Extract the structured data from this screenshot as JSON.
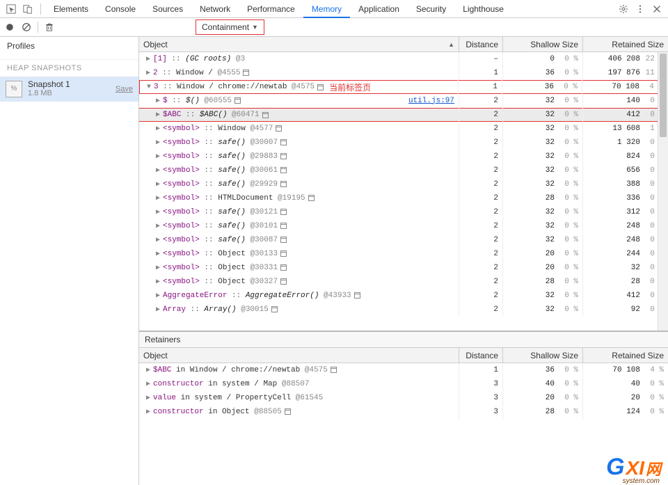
{
  "tabs": [
    "Elements",
    "Console",
    "Sources",
    "Network",
    "Performance",
    "Memory",
    "Application",
    "Security",
    "Lighthouse"
  ],
  "active_tab": "Memory",
  "dropdown": {
    "label": "Containment"
  },
  "sidebar": {
    "profiles_label": "Profiles",
    "section_label": "HEAP SNAPSHOTS",
    "snapshot_name": "Snapshot 1",
    "snapshot_size": "1.8 MB",
    "save_label": "Save"
  },
  "columns": {
    "object": "Object",
    "distance": "Distance",
    "shallow": "Shallow Size",
    "retained": "Retained Size"
  },
  "rows": [
    {
      "indent": 0,
      "exp": "closed",
      "key": "[1]",
      "sep": " :: ",
      "ctor": "(GC roots)",
      "objid": "@3",
      "win": false,
      "dist": "–",
      "shallow": "0",
      "spct": "0 %",
      "ret": "406 208",
      "rpct": "22 %"
    },
    {
      "indent": 0,
      "exp": "closed",
      "key": "2",
      "sep": " :: ",
      "prefix": "Window / ",
      "objid": "@4555",
      "win": true,
      "dist": "1",
      "shallow": "36",
      "spct": "0 %",
      "ret": "197 876",
      "rpct": "11 %"
    },
    {
      "indent": 0,
      "exp": "open",
      "key": "3",
      "sep": " :: ",
      "prefix": "Window / chrome://newtab ",
      "objid": "@4575",
      "win": true,
      "badge": "当前标签页",
      "dist": "1",
      "shallow": "36",
      "spct": "0 %",
      "ret": "70 108",
      "rpct": "4 %",
      "redbox": true
    },
    {
      "indent": 1,
      "exp": "closed",
      "key": "$",
      "sep": " :: ",
      "ctor": "$()",
      "objid": "@60555",
      "win": true,
      "link": "util.js:97",
      "dist": "2",
      "shallow": "32",
      "spct": "0 %",
      "ret": "140",
      "rpct": "0 %"
    },
    {
      "indent": 1,
      "exp": "closed",
      "key": "$ABC",
      "sep": " :: ",
      "ctor": "$ABC()",
      "objid": "@60471",
      "win": true,
      "dist": "2",
      "shallow": "32",
      "spct": "0 %",
      "ret": "412",
      "rpct": "0 %",
      "highlight": true
    },
    {
      "indent": 1,
      "exp": "closed",
      "key": "<symbol>",
      "sep": " :: ",
      "prefix": "Window ",
      "objid": "@4577",
      "win": true,
      "dist": "2",
      "shallow": "32",
      "spct": "0 %",
      "ret": "13 608",
      "rpct": "1 %"
    },
    {
      "indent": 1,
      "exp": "closed",
      "key": "<symbol>",
      "sep": " :: ",
      "ctor": "safe()",
      "objid": "@30007",
      "win": true,
      "dist": "2",
      "shallow": "32",
      "spct": "0 %",
      "ret": "1 320",
      "rpct": "0 %"
    },
    {
      "indent": 1,
      "exp": "closed",
      "key": "<symbol>",
      "sep": " :: ",
      "ctor": "safe()",
      "objid": "@29883",
      "win": true,
      "dist": "2",
      "shallow": "32",
      "spct": "0 %",
      "ret": "824",
      "rpct": "0 %"
    },
    {
      "indent": 1,
      "exp": "closed",
      "key": "<symbol>",
      "sep": " :: ",
      "ctor": "safe()",
      "objid": "@30061",
      "win": true,
      "dist": "2",
      "shallow": "32",
      "spct": "0 %",
      "ret": "656",
      "rpct": "0 %"
    },
    {
      "indent": 1,
      "exp": "closed",
      "key": "<symbol>",
      "sep": " :: ",
      "ctor": "safe()",
      "objid": "@29929",
      "win": true,
      "dist": "2",
      "shallow": "32",
      "spct": "0 %",
      "ret": "388",
      "rpct": "0 %"
    },
    {
      "indent": 1,
      "exp": "closed",
      "key": "<symbol>",
      "sep": " :: ",
      "prefix": "HTMLDocument ",
      "objid": "@19195",
      "win": true,
      "dist": "2",
      "shallow": "28",
      "spct": "0 %",
      "ret": "336",
      "rpct": "0 %"
    },
    {
      "indent": 1,
      "exp": "closed",
      "key": "<symbol>",
      "sep": " :: ",
      "ctor": "safe()",
      "objid": "@30121",
      "win": true,
      "dist": "2",
      "shallow": "32",
      "spct": "0 %",
      "ret": "312",
      "rpct": "0 %"
    },
    {
      "indent": 1,
      "exp": "closed",
      "key": "<symbol>",
      "sep": " :: ",
      "ctor": "safe()",
      "objid": "@30101",
      "win": true,
      "dist": "2",
      "shallow": "32",
      "spct": "0 %",
      "ret": "248",
      "rpct": "0 %"
    },
    {
      "indent": 1,
      "exp": "closed",
      "key": "<symbol>",
      "sep": " :: ",
      "ctor": "safe()",
      "objid": "@30087",
      "win": true,
      "dist": "2",
      "shallow": "32",
      "spct": "0 %",
      "ret": "248",
      "rpct": "0 %"
    },
    {
      "indent": 1,
      "exp": "closed",
      "key": "<symbol>",
      "sep": " :: ",
      "prefix": "Object ",
      "objid": "@30133",
      "win": true,
      "dist": "2",
      "shallow": "20",
      "spct": "0 %",
      "ret": "244",
      "rpct": "0 %"
    },
    {
      "indent": 1,
      "exp": "closed",
      "key": "<symbol>",
      "sep": " :: ",
      "prefix": "Object ",
      "objid": "@30331",
      "win": true,
      "dist": "2",
      "shallow": "20",
      "spct": "0 %",
      "ret": "32",
      "rpct": "0 %"
    },
    {
      "indent": 1,
      "exp": "closed",
      "key": "<symbol>",
      "sep": " :: ",
      "prefix": "Object ",
      "objid": "@30327",
      "win": true,
      "dist": "2",
      "shallow": "28",
      "spct": "0 %",
      "ret": "28",
      "rpct": "0 %"
    },
    {
      "indent": 1,
      "exp": "closed",
      "key": "AggregateError",
      "sep": " :: ",
      "ctor": "AggregateError()",
      "objid": "@43933",
      "win": true,
      "dist": "2",
      "shallow": "32",
      "spct": "0 %",
      "ret": "412",
      "rpct": "0 %"
    },
    {
      "indent": 1,
      "exp": "closed",
      "key": "Array",
      "sep": " :: ",
      "ctor": "Array()",
      "objid": "@30015",
      "win": true,
      "dist": "2",
      "shallow": "32",
      "spct": "0 %",
      "ret": "92",
      "rpct": "0 %"
    }
  ],
  "retainers": {
    "label": "Retainers",
    "rows": [
      {
        "indent": 0,
        "exp": "closed",
        "key": "$ABC",
        "rest": " in Window / chrome://newtab ",
        "objid": "@4575",
        "win": true,
        "dist": "1",
        "shallow": "36",
        "spct": "0 %",
        "ret": "70 108",
        "rpct": "4 %"
      },
      {
        "indent": 0,
        "exp": "closed",
        "key": "constructor",
        "rest": " in system / Map ",
        "objid": "@88507",
        "dist": "3",
        "shallow": "40",
        "spct": "0 %",
        "ret": "40",
        "rpct": "0 %"
      },
      {
        "indent": 0,
        "exp": "closed",
        "key": "value",
        "rest": " in system / PropertyCell ",
        "objid": "@61545",
        "dist": "3",
        "shallow": "20",
        "spct": "0 %",
        "ret": "20",
        "rpct": "0 %"
      },
      {
        "indent": 0,
        "exp": "closed",
        "key": "constructor",
        "rest": " in Object ",
        "objid": "@88505",
        "win": true,
        "dist": "3",
        "shallow": "28",
        "spct": "0 %",
        "ret": "124",
        "rpct": "0 %"
      }
    ]
  },
  "watermark": {
    "g": "G",
    "xi": "XI",
    "net": "网",
    "sub": "system.com"
  }
}
